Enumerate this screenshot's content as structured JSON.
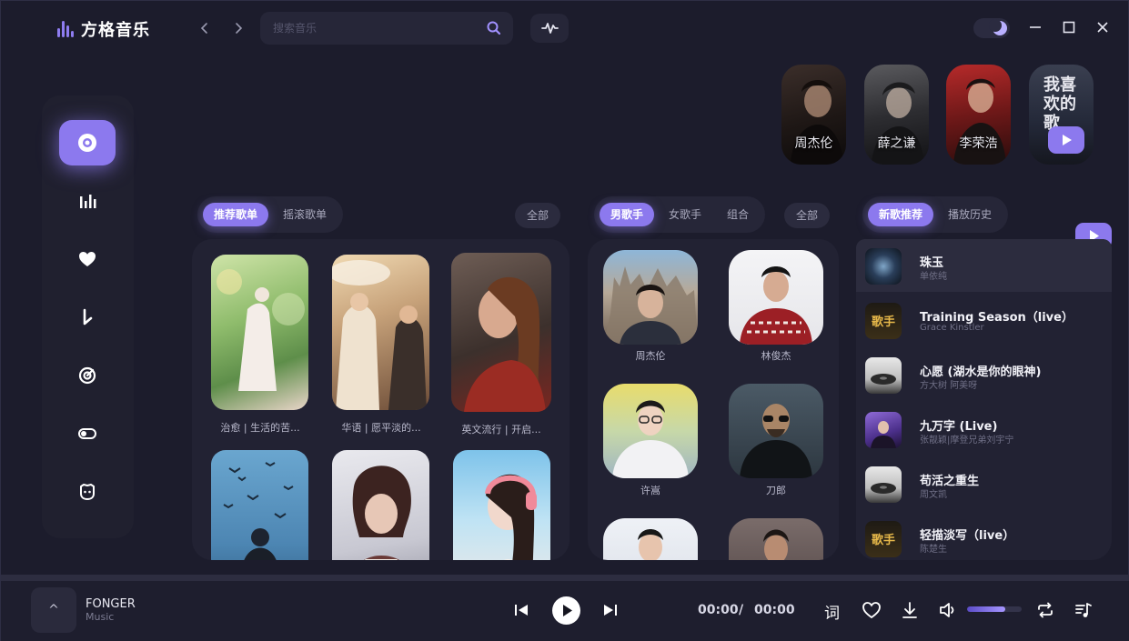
{
  "app": {
    "title": "方格音乐",
    "search_placeholder": "搜索音乐",
    "brand_color": "#8c79ee"
  },
  "sidebar": {
    "items": [
      {
        "icon": "disc-icon",
        "active": true
      },
      {
        "icon": "chart-bars-icon",
        "active": false
      },
      {
        "icon": "heart-icon",
        "active": false
      },
      {
        "icon": "download-icon",
        "active": false
      },
      {
        "icon": "radar-icon",
        "active": false
      },
      {
        "icon": "toggle-icon",
        "active": false
      },
      {
        "icon": "cat-face-icon",
        "active": false
      }
    ]
  },
  "top_singers": [
    {
      "name": "周杰伦"
    },
    {
      "name": "薛之谦"
    },
    {
      "name": "李荣浩"
    }
  ],
  "my_likes": {
    "label": "我喜欢的歌"
  },
  "playlists": {
    "tabs": [
      "推荐歌单",
      "摇滚歌单"
    ],
    "all_label": "全部",
    "items": [
      {
        "title": "治愈 | 生活的苦..."
      },
      {
        "title": "华语 | 愿平淡的..."
      },
      {
        "title": "英文流行 | 开启..."
      },
      {
        "title": ""
      },
      {
        "title": ""
      },
      {
        "title": ""
      }
    ]
  },
  "artists": {
    "tabs": [
      "男歌手",
      "女歌手",
      "组合"
    ],
    "all_label": "全部",
    "items": [
      {
        "name": "周杰伦"
      },
      {
        "name": "林俊杰"
      },
      {
        "name": "许嵩"
      },
      {
        "name": "刀郎"
      },
      {
        "name": ""
      },
      {
        "name": ""
      }
    ]
  },
  "songs": {
    "tabs": [
      "新歌推荐",
      "播放历史"
    ],
    "items": [
      {
        "title": "珠玉",
        "artist": "单依纯"
      },
      {
        "title": "Training Season（live）",
        "artist": "Grace Kinstler"
      },
      {
        "title": "心愿 (湖水是你的眼神)",
        "artist": "方大树 阿美呀"
      },
      {
        "title": "九万字 (Live)",
        "artist": "张靓颖|摩登兄弟刘宇宁"
      },
      {
        "title": "苟活之重生",
        "artist": "周文凯"
      },
      {
        "title": "轻描淡写（live）",
        "artist": "陈楚生"
      }
    ]
  },
  "player": {
    "cover_label": "^",
    "track_title": "FONGER",
    "track_subtitle": "Music",
    "current_time": "00:00",
    "separator": "/",
    "total_time": "00:00",
    "lyrics_label": "词",
    "volume_level": 0.7
  }
}
